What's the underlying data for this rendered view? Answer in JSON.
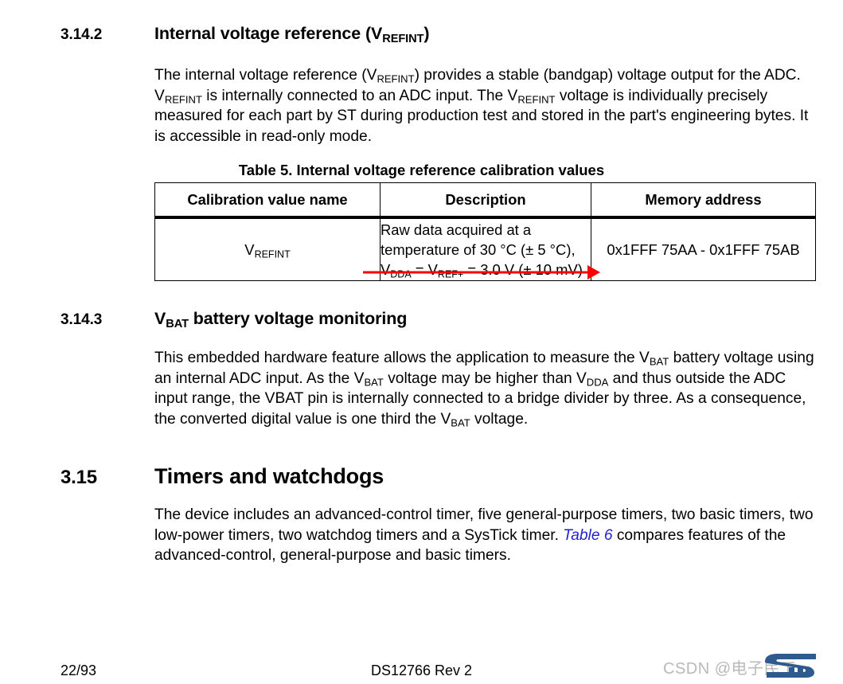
{
  "document": {
    "section_3142": {
      "number": "3.14.2",
      "title_prefix": "Internal voltage reference (V",
      "title_sub": "REFINT",
      "title_suffix": ")",
      "paragraph_html": "The internal voltage reference (V<sub>REFINT</sub>) provides a stable (bandgap) voltage output for the ADC. V<sub>REFINT</sub> is internally connected to an ADC input. The V<sub>REFINT</sub> voltage is individually precisely measured for each part by ST during production test and stored in the part's engineering bytes. It is accessible in read-only mode."
    },
    "table5": {
      "caption": "Table 5. Internal voltage reference calibration values",
      "headers": [
        "Calibration value name",
        "Description",
        "Memory address"
      ],
      "rows": [
        {
          "name_html": "V<sub>REFINT</sub>",
          "description_html": "Raw data acquired at a temperature of 30 °C (± 5 °C), V<sub>DDA</sub> = V<sub>REF+</sub> = 3.0 V (± 10 mV)",
          "memory_address": "0x1FFF 75AA - 0x1FFF 75AB"
        }
      ],
      "annotation": {
        "type": "arrow",
        "color": "#ff0000",
        "direction": "right",
        "points_to": "description-cell-bottom"
      }
    },
    "section_3143": {
      "number": "3.14.3",
      "title_prefix": "V",
      "title_sub": "BAT",
      "title_suffix": " battery voltage monitoring",
      "paragraph_html": "This embedded hardware feature allows the application to measure the V<sub>BAT</sub> battery voltage using an internal ADC input. As the V<sub>BAT</sub> voltage may be higher than V<sub>DDA</sub> and thus outside the ADC input range, the VBAT pin is internally connected to a bridge divider by three. As a consequence, the converted digital value is one third the V<sub>BAT</sub> voltage."
    },
    "section_315": {
      "number": "3.15",
      "title": "Timers and watchdogs",
      "paragraph_html": "The device includes an advanced-control timer, five general-purpose timers, two basic timers, two low-power timers, two watchdog timers and a SysTick timer. <a class=\"xref\" href=\"#\" data-name=\"table-6-crossref-link\" data-interactable=\"true\">Table 6</a> compares features of the advanced-control, general-purpose and basic timers."
    }
  },
  "footer": {
    "page_number": "22/93",
    "doc_id": "DS12766 Rev 2"
  },
  "watermark": {
    "text": "CSDN @电子民工",
    "color": "#b9b9b9",
    "logo_name": "st-logo",
    "logo_color": "#2e5a8e"
  }
}
